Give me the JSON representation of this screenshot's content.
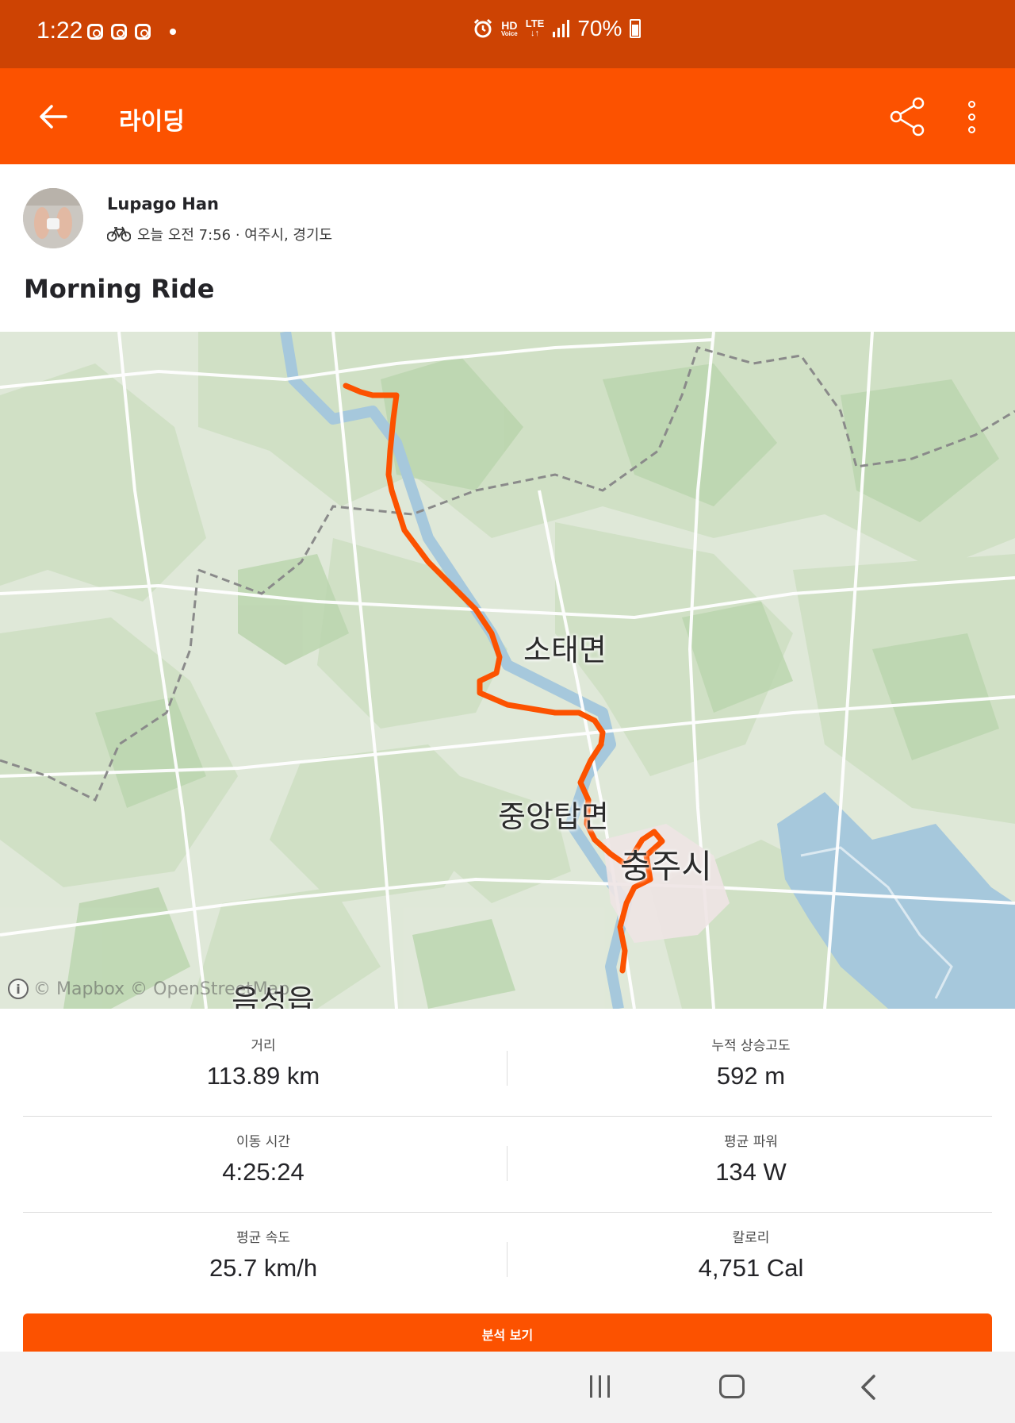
{
  "status_bar": {
    "time": "1:22",
    "network_hd": "HD",
    "network_voice": "Voice",
    "network_lte": "LTE",
    "battery": "70%"
  },
  "app_bar": {
    "title": "라이딩",
    "back_icon": "arrow-left-icon",
    "share_icon": "share-icon",
    "more_icon": "more-vertical-icon"
  },
  "activity": {
    "athlete_name": "Lupago Han",
    "sport_icon": "bike-icon",
    "meta": "오늘 오전 7:56 · 여주시, 경기도",
    "title": "Morning Ride"
  },
  "map": {
    "labels": {
      "town1": "소태면",
      "town2": "중앙탑면",
      "city": "충주시",
      "town3": "음성읍"
    },
    "attribution": "© Mapbox © OpenStreetMap",
    "route_color": "#fc5200"
  },
  "stats": {
    "distance": {
      "label": "거리",
      "value": "113.89 km"
    },
    "elevation": {
      "label": "누적 상승고도",
      "value": "592 m"
    },
    "moving_time": {
      "label": "이동 시간",
      "value": "4:25:24"
    },
    "avg_power": {
      "label": "평균 파워",
      "value": "134 W"
    },
    "avg_speed": {
      "label": "평균 속도",
      "value": "25.7 km/h"
    },
    "calories": {
      "label": "칼로리",
      "value": "4,751 Cal"
    }
  },
  "actions": {
    "analysis_button": "분석 보기"
  },
  "colors": {
    "brand": "#fc5200",
    "status_bar": "#cd4303"
  }
}
